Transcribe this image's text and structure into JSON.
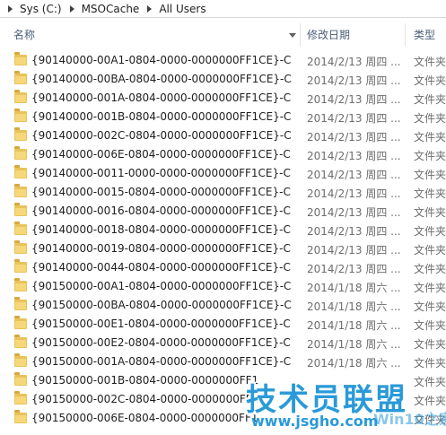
{
  "breadcrumb": [
    "Sys (C:)",
    "MSOCache",
    "All Users"
  ],
  "columns": {
    "name": "名称",
    "date": "修改日期",
    "type": "类型"
  },
  "rows": [
    {
      "name": "{90140000-00A1-0804-0000-0000000FF1CE}-C",
      "date": "2014/2/13 周四 ...",
      "type": "文件夹"
    },
    {
      "name": "{90140000-00BA-0804-0000-0000000FF1CE}-C",
      "date": "2014/2/13 周四 ...",
      "type": "文件夹"
    },
    {
      "name": "{90140000-001A-0804-0000-0000000FF1CE}-C",
      "date": "2014/2/13 周四 ...",
      "type": "文件夹"
    },
    {
      "name": "{90140000-001B-0804-0000-0000000FF1CE}-C",
      "date": "2014/2/13 周四 ...",
      "type": "文件夹"
    },
    {
      "name": "{90140000-002C-0804-0000-0000000FF1CE}-C",
      "date": "2014/2/13 周四 ...",
      "type": "文件夹"
    },
    {
      "name": "{90140000-006E-0804-0000-0000000FF1CE}-C",
      "date": "2014/2/13 周四 ...",
      "type": "文件夹"
    },
    {
      "name": "{90140000-0011-0000-0000-0000000FF1CE}-C",
      "date": "2014/2/13 周四 ...",
      "type": "文件夹"
    },
    {
      "name": "{90140000-0015-0804-0000-0000000FF1CE}-C",
      "date": "2014/2/13 周四 ...",
      "type": "文件夹"
    },
    {
      "name": "{90140000-0016-0804-0000-0000000FF1CE}-C",
      "date": "2014/2/13 周四 ...",
      "type": "文件夹"
    },
    {
      "name": "{90140000-0018-0804-0000-0000000FF1CE}-C",
      "date": "2014/2/13 周四 ...",
      "type": "文件夹"
    },
    {
      "name": "{90140000-0019-0804-0000-0000000FF1CE}-C",
      "date": "2014/2/13 周四 ...",
      "type": "文件夹"
    },
    {
      "name": "{90140000-0044-0804-0000-0000000FF1CE}-C",
      "date": "2014/2/13 周四 ...",
      "type": "文件夹"
    },
    {
      "name": "{90150000-00A1-0804-0000-0000000FF1CE}-C",
      "date": "2014/1/18 周六 ...",
      "type": "文件夹"
    },
    {
      "name": "{90150000-00BA-0804-0000-0000000FF1CE}-C",
      "date": "2014/1/18 周六 ...",
      "type": "文件夹"
    },
    {
      "name": "{90150000-00E1-0804-0000-0000000FF1CE}-C",
      "date": "2014/1/18 周六 ...",
      "type": "文件夹"
    },
    {
      "name": "{90150000-00E2-0804-0000-0000000FF1CE}-C",
      "date": "2014/1/18 周六 ...",
      "type": "文件夹"
    },
    {
      "name": "{90150000-001A-0804-0000-0000000FF1CE}-C",
      "date": "2014/1/18 周六 ...",
      "type": "文件夹"
    },
    {
      "name": "{90150000-001B-0804-0000-0000000FF1",
      "date": "",
      "type": "文件夹"
    },
    {
      "name": "{90150000-002C-0804-0000-0000000FF1",
      "date": "",
      "type": "文件夹"
    },
    {
      "name": "{90150000-006E-0804-0000-0000000FF1",
      "date": "",
      "type": "文件夹"
    }
  ],
  "watermark": {
    "title": "技术员联盟",
    "url": "www.jsgho.com",
    "tag": "Win10之家"
  },
  "colors": {
    "folder": "#e9c35a",
    "header_text": "#4c607a",
    "watermark": "#2a9ad8"
  }
}
